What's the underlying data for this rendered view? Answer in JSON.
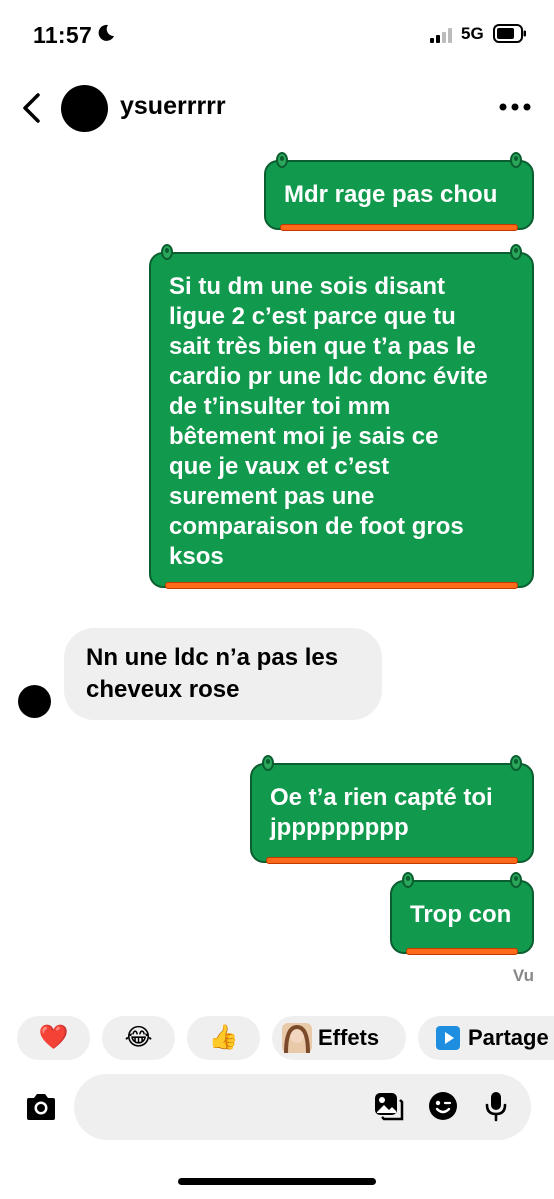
{
  "status": {
    "time": "11:57",
    "network": "5G"
  },
  "header": {
    "username": "ysuerrrrr"
  },
  "messages": {
    "m1": "Mdr rage pas chou",
    "m2": "Si tu dm une sois disant\nligue 2 c’est parce que tu\nsait très bien que t’a pas le\ncardio pr une ldc donc évite\nde t’insulter toi mm\nbêtement moi je sais ce\nque je vaux et c’est\nsurement pas une\ncomparaison de foot gros\nksos",
    "m3": "Nn une ldc n’a pas les\ncheveux rose",
    "m4": "Oe t’a rien capté toi\njppppppppp",
    "m5": "Trop con"
  },
  "seen_label": "Vu",
  "reactions": {
    "heart": "❤️",
    "laugh": "😂",
    "thumbs": "👍",
    "effects_label": "Effets",
    "share_label": "Partage"
  },
  "colors": {
    "bubble": "#119a4d",
    "accent_bar": "#ff6a1a",
    "incoming": "#efefef"
  }
}
